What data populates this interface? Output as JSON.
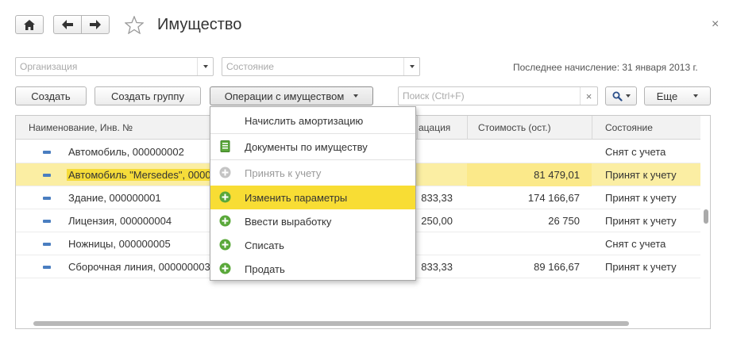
{
  "window": {
    "title": "Имущество",
    "close_symbol": "×"
  },
  "filters": {
    "organization_placeholder": "Организация",
    "state_placeholder": "Состояние",
    "last_accrual": "Последнее начисление: 31 января 2013 г."
  },
  "toolbar": {
    "create": "Создать",
    "create_group": "Создать группу",
    "operations": "Операции с имуществом",
    "search_placeholder": "Поиск (Ctrl+F)",
    "search_clear": "×",
    "more": "Еще"
  },
  "table": {
    "columns": {
      "name": "Наименование, Инв. №",
      "depreciation": "ацация",
      "cost": "Стоимость (ост.)",
      "state": "Состояние"
    },
    "rows": [
      {
        "name": "Автомобиль, 000000002",
        "depreciation": "",
        "cost": "",
        "state": "Снят с учета"
      },
      {
        "name": "Автомобиль \"Mersedes\", 0000",
        "depreciation": "",
        "cost": "81 479,01",
        "state": "Принят к учету"
      },
      {
        "name": "Здание, 000000001",
        "depreciation": "833,33",
        "cost": "174 166,67",
        "state": "Принят к учету"
      },
      {
        "name": "Лицензия, 000000004",
        "depreciation": "250,00",
        "cost": "26 750",
        "state": "Принят к учету"
      },
      {
        "name": "Ножницы, 000000005",
        "depreciation": "",
        "cost": "",
        "state": "Снят с учета"
      },
      {
        "name": "Сборочная линия, 000000003",
        "depreciation": "833,33",
        "cost": "89 166,67",
        "state": "Принят к учету"
      }
    ]
  },
  "menu": {
    "items": [
      {
        "label": "Начислить амортизацию",
        "icon": "none"
      },
      {
        "label": "Документы по имуществу",
        "icon": "document-list-icon"
      },
      {
        "label": "Принять к учету",
        "icon": "plus-circle-icon",
        "disabled": true
      },
      {
        "label": "Изменить параметры",
        "icon": "plus-circle-icon",
        "highlighted": true
      },
      {
        "label": "Ввести выработку",
        "icon": "plus-circle-icon"
      },
      {
        "label": "Списать",
        "icon": "plus-circle-icon"
      },
      {
        "label": "Продать",
        "icon": "plus-circle-icon"
      }
    ]
  },
  "colors": {
    "selected_row": "#fbeea3",
    "menu_highlight": "#f8dd34",
    "icon_green": "#5aa83a"
  }
}
